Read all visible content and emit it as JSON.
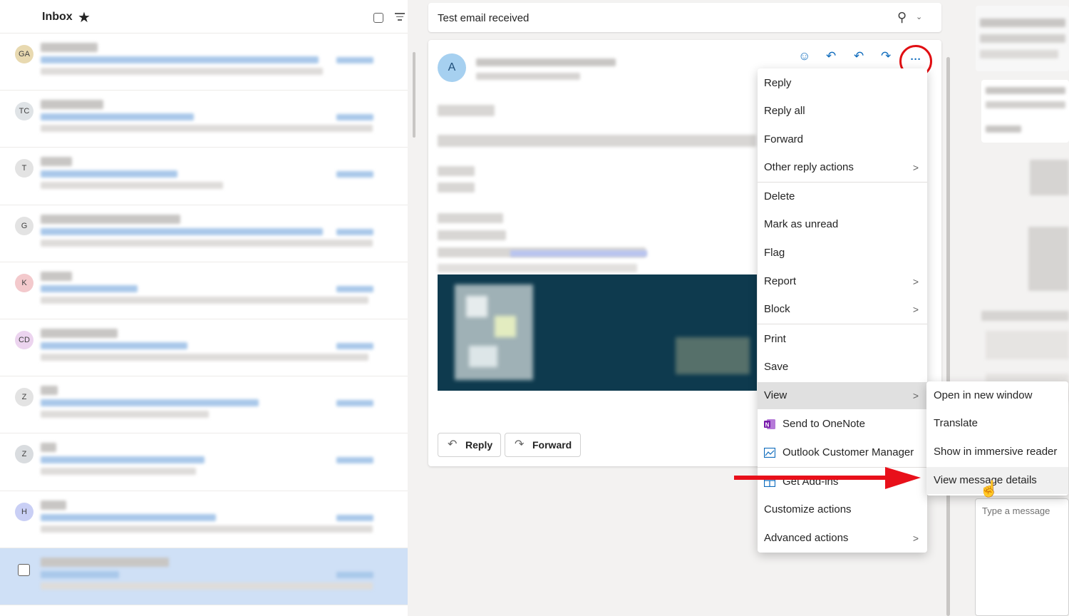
{
  "inbox": {
    "title": "Inbox",
    "items": [
      {
        "initials": "GA",
        "color": "#e8d9b0"
      },
      {
        "initials": "TC",
        "color": "#dfe3e6"
      },
      {
        "initials": "T",
        "color": "#e3e3e3"
      },
      {
        "initials": "G",
        "color": "#e3e3e3"
      },
      {
        "initials": "K",
        "color": "#f3c9cc"
      },
      {
        "initials": "CD",
        "color": "#ecd4ef"
      },
      {
        "initials": "Z",
        "color": "#e3e3e3"
      },
      {
        "initials": "Z",
        "color": "#d9dcdf"
      },
      {
        "initials": "H",
        "color": "#c9cff5"
      },
      {
        "initials": "",
        "color": "#cfe0f6",
        "selected": true
      }
    ]
  },
  "reading": {
    "subject": "Test email received",
    "sender_initial": "A",
    "reply_button": "Reply",
    "forward_button": "Forward"
  },
  "menu": {
    "items": [
      "Reply",
      "Reply all",
      "Forward",
      "Other reply actions",
      "Delete",
      "Mark as unread",
      "Flag",
      "Report",
      "Block",
      "Print",
      "Save",
      "View",
      "Send to OneNote",
      "Outlook Customer Manager",
      "Get Add-ins",
      "Customize actions",
      "Advanced actions"
    ]
  },
  "submenu": {
    "items": [
      "Open in new window",
      "Translate",
      "Show in immersive reader",
      "View message details"
    ]
  },
  "compose": {
    "placeholder": "Type a message"
  },
  "colors": {
    "accent": "#0f6cbd",
    "highlight_circle": "#e10e12",
    "arrow": "#e8101a",
    "selected_row": "#cfe0f6"
  }
}
